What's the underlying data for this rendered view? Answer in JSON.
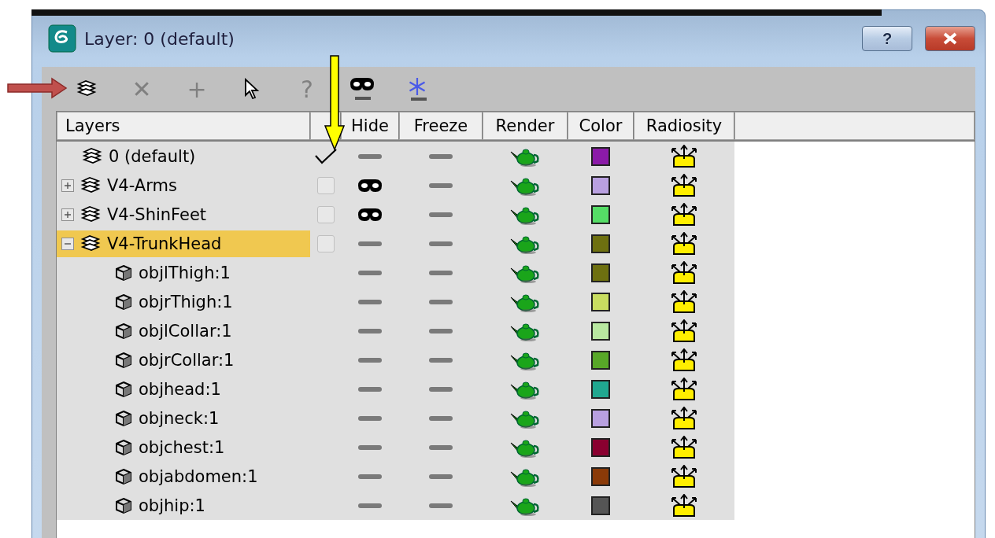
{
  "window": {
    "title": "Layer: 0 (default)",
    "help_button": "?"
  },
  "toolbar": [
    {
      "kind": "new-layer",
      "disabled": false
    },
    {
      "kind": "glyph",
      "glyph": "✕",
      "disabled": true
    },
    {
      "kind": "glyph",
      "glyph": "+",
      "disabled": true
    },
    {
      "kind": "select",
      "disabled": false
    },
    {
      "kind": "glyph",
      "glyph": "?",
      "disabled": true
    },
    {
      "kind": "hide",
      "disabled": false
    },
    {
      "kind": "freeze",
      "disabled": false
    }
  ],
  "table": {
    "columns": [
      "Layers",
      "Hide",
      "Freeze",
      "Render",
      "Color",
      "Radiosity"
    ],
    "rows": [
      {
        "kind": "layer",
        "name": "0 (default)",
        "selected": false,
        "current": true,
        "hidden": false,
        "frozen": false,
        "renderable": true,
        "radiosity": true,
        "color": "#8b1aa8"
      },
      {
        "kind": "layer",
        "name": "V4-Arms",
        "selected": false,
        "expanded": false,
        "current": false,
        "hidden": true,
        "frozen": false,
        "renderable": true,
        "radiosity": true,
        "color": "#b9a0e0",
        "children": []
      },
      {
        "kind": "layer",
        "name": "V4-ShinFeet",
        "selected": false,
        "expanded": false,
        "current": false,
        "hidden": true,
        "frozen": false,
        "renderable": true,
        "radiosity": true,
        "color": "#55dd66",
        "children": []
      },
      {
        "kind": "layer",
        "name": "V4-TrunkHead",
        "selected": true,
        "expanded": true,
        "current": false,
        "hidden": false,
        "frozen": false,
        "renderable": true,
        "radiosity": true,
        "color": "#6e7010",
        "children": [
          {
            "kind": "object",
            "name": "objlThigh:1",
            "selected": false,
            "hidden": false,
            "frozen": false,
            "renderable": true,
            "radiosity": true,
            "color": "#6e7010"
          },
          {
            "kind": "object",
            "name": "objrThigh:1",
            "selected": false,
            "hidden": false,
            "frozen": false,
            "renderable": true,
            "radiosity": true,
            "color": "#c8dd60"
          },
          {
            "kind": "object",
            "name": "objlCollar:1",
            "selected": false,
            "hidden": false,
            "frozen": false,
            "renderable": true,
            "radiosity": true,
            "color": "#b8e8a0"
          },
          {
            "kind": "object",
            "name": "objrCollar:1",
            "selected": false,
            "hidden": false,
            "frozen": false,
            "renderable": true,
            "radiosity": true,
            "color": "#58a828"
          },
          {
            "kind": "object",
            "name": "objhead:1",
            "selected": false,
            "hidden": false,
            "frozen": false,
            "renderable": true,
            "radiosity": true,
            "color": "#20a890"
          },
          {
            "kind": "object",
            "name": "objneck:1",
            "selected": false,
            "hidden": false,
            "frozen": false,
            "renderable": true,
            "radiosity": true,
            "color": "#b8a0e0"
          },
          {
            "kind": "object",
            "name": "objchest:1",
            "selected": false,
            "hidden": false,
            "frozen": false,
            "renderable": true,
            "radiosity": true,
            "color": "#8a0030"
          },
          {
            "kind": "object",
            "name": "objabdomen:1",
            "selected": false,
            "hidden": false,
            "frozen": false,
            "renderable": true,
            "radiosity": true,
            "color": "#8a3a08"
          },
          {
            "kind": "object",
            "name": "objhip:1",
            "selected": false,
            "hidden": false,
            "frozen": false,
            "renderable": true,
            "radiosity": true,
            "color": "#555555"
          }
        ]
      }
    ]
  }
}
